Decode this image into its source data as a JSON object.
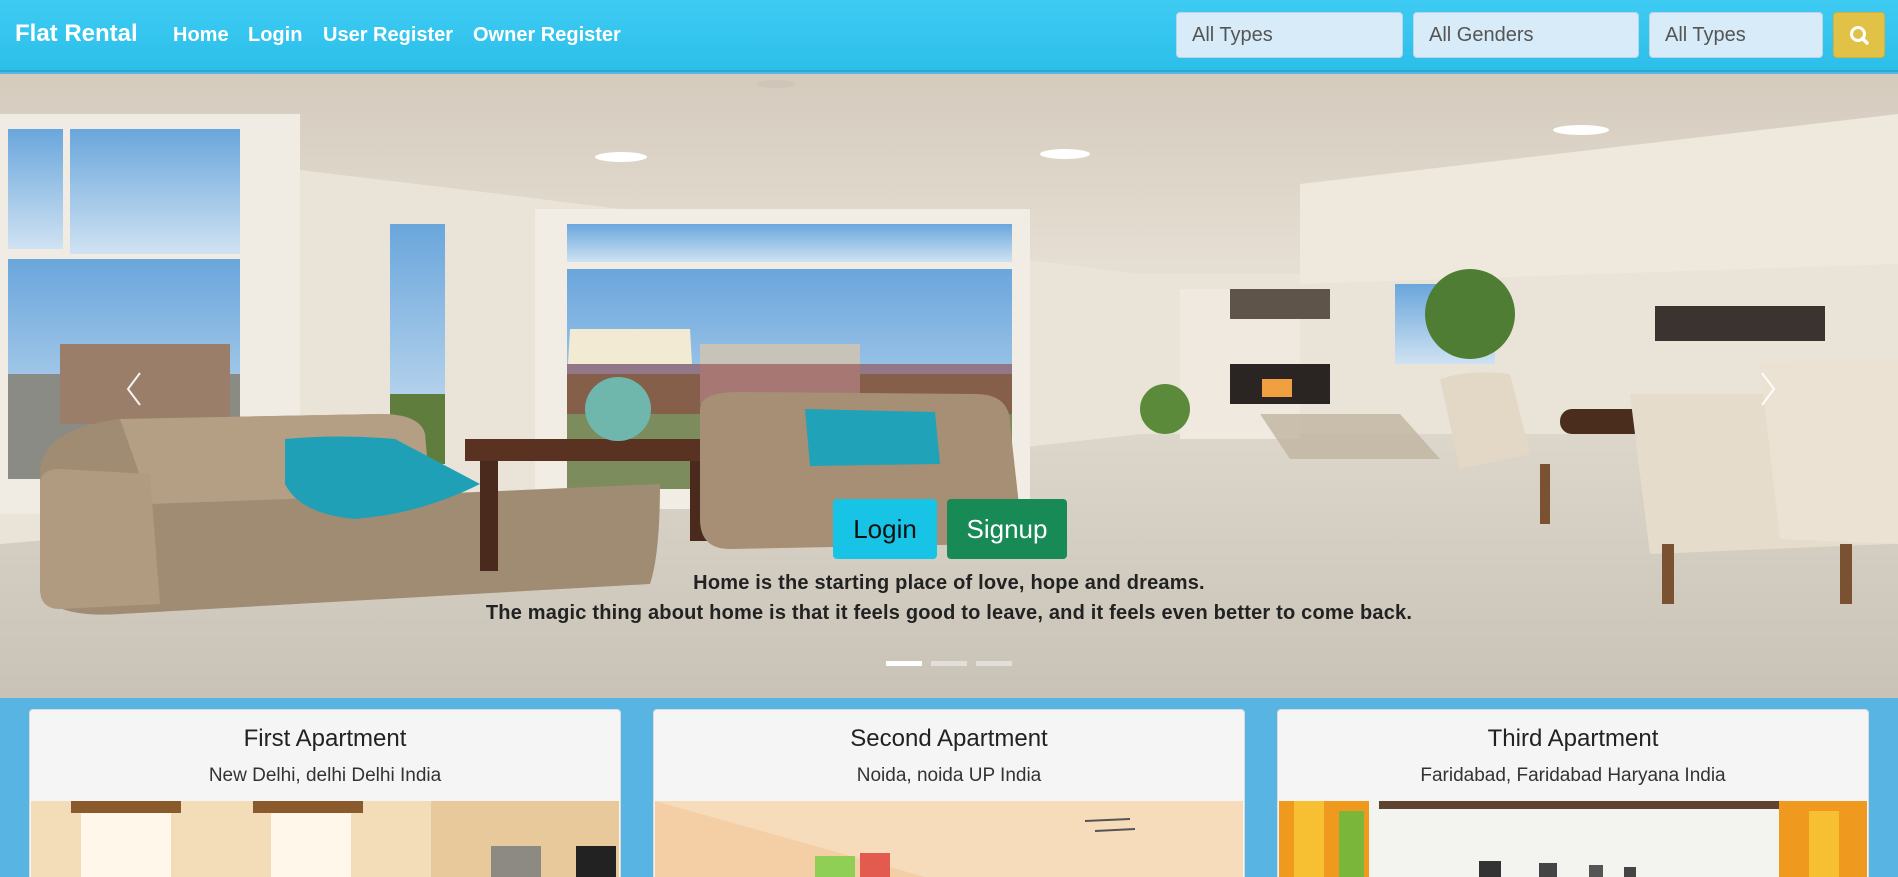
{
  "navbar": {
    "brand": "Flat Rental",
    "links": [
      "Home",
      "Login",
      "User Register",
      "Owner Register"
    ],
    "filters": {
      "type": "All Types",
      "gender": "All Genders",
      "type2": "All Types"
    },
    "search_icon": "search-icon"
  },
  "hero": {
    "login_label": "Login",
    "signup_label": "Signup",
    "quote_line1": "Home is the starting place of love, hope and dreams.",
    "quote_line2": "The magic thing about home is that it feels good to leave, and it feels even better to come back.",
    "slide_count": 3,
    "active_slide": 1
  },
  "apartments": [
    {
      "title": "First Apartment",
      "location": "New Delhi, delhi Delhi India"
    },
    {
      "title": "Second Apartment",
      "location": "Noida, noida UP India"
    },
    {
      "title": "Third Apartment",
      "location": "Faridabad, Faridabad Haryana India"
    }
  ],
  "colors": {
    "navbar": "#2cbfe9",
    "page_bg": "#58b4e2",
    "login_button": "#17c4e6",
    "signup_button": "#178a55",
    "search_button": "#e2c246"
  }
}
